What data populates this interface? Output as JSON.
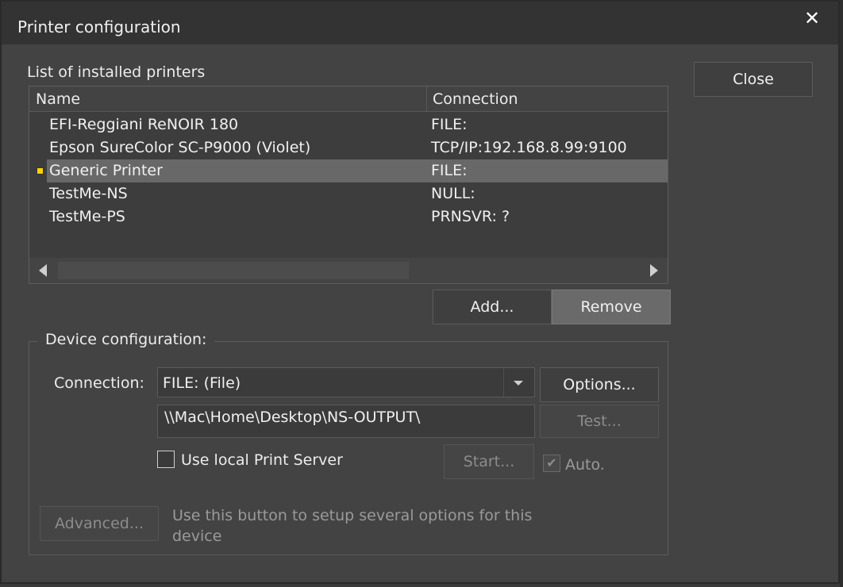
{
  "window": {
    "title": "Printer configuration",
    "close_glyph": "✕"
  },
  "printers": {
    "label": "List of installed printers",
    "columns": [
      "Name",
      "Connection"
    ],
    "rows": [
      {
        "name": "EFI-Reggiani ReNOIR 180",
        "connection": "FILE:",
        "selected": false
      },
      {
        "name": "Epson SureColor SC-P9000 (Violet)",
        "connection": "TCP/IP:192.168.8.99:9100",
        "selected": false
      },
      {
        "name": "Generic Printer",
        "connection": "FILE:",
        "selected": true
      },
      {
        "name": "TestMe-NS",
        "connection": "NULL:",
        "selected": false
      },
      {
        "name": "TestMe-PS",
        "connection": "PRNSVR: ?",
        "selected": false
      }
    ]
  },
  "buttons": {
    "close": "Close",
    "add": "Add...",
    "remove": "Remove",
    "options": "Options...",
    "test": "Test...",
    "start": "Start...",
    "advanced": "Advanced..."
  },
  "device": {
    "legend": "Device configuration:",
    "connection_label": "Connection:",
    "connection_value": "FILE: (File)",
    "path_value": "\\\\Mac\\Home\\Desktop\\NS-OUTPUT\\",
    "use_local_label": "Use local Print Server",
    "use_local_checked": false,
    "auto_label": "Auto.",
    "auto_checked": true,
    "advanced_hint": "Use this button to setup several options for this device"
  },
  "colors": {
    "background": "#434343",
    "titlebar": "#333333",
    "selected_row": "#686868",
    "row_marker": "#ffd400"
  }
}
